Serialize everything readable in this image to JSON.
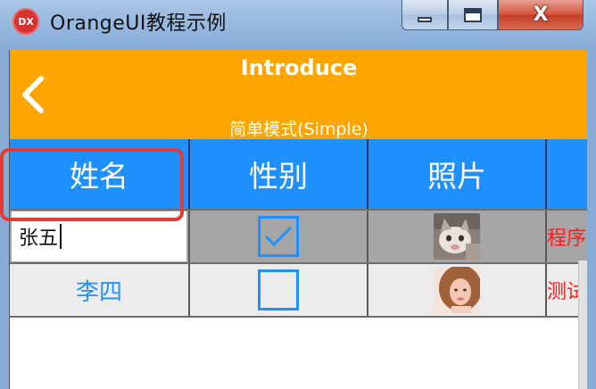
{
  "window": {
    "title": "OrangeUI教程示例",
    "icon_label": "DX",
    "controls": {
      "minimize": "minimize-icon",
      "maximize": "maximize-icon",
      "close": "close-icon"
    }
  },
  "header": {
    "title": "Introduce",
    "subtitle": "简单模式(Simple)",
    "back_icon": "chevron-left-icon",
    "color": "#ffa500"
  },
  "table": {
    "columns": [
      "姓名",
      "性别",
      "照片",
      ""
    ],
    "header_color": "#1e90ff",
    "rows": [
      {
        "name": "张五",
        "checked": true,
        "photo": "cat-photo",
        "desc": "程序"
      },
      {
        "name": "李四",
        "checked": false,
        "photo": "portrait-photo",
        "desc": "测试"
      }
    ]
  },
  "colors": {
    "accent": "#1e90ff",
    "highlight": "#e53935",
    "desc_text": "#ff1c1c"
  }
}
